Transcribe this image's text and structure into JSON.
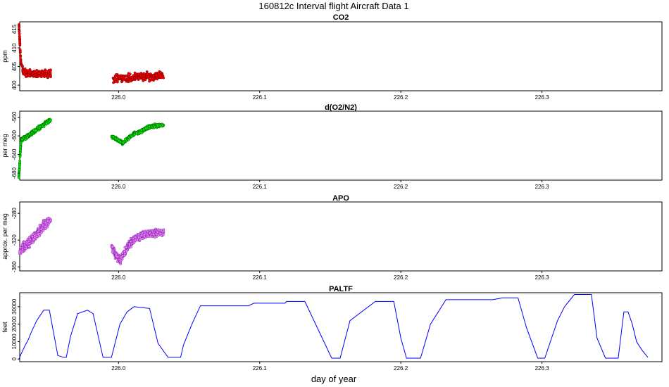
{
  "figure": {
    "title": "160812c   Interval flight Aircraft Data 1",
    "xlabel": "day of year"
  },
  "chart_data": [
    {
      "type": "scatter",
      "title": "CO2",
      "ylabel": "ppm",
      "xlim": [
        225.93,
        226.385
      ],
      "ylim": [
        398.5,
        417.0
      ],
      "xticks": [
        226.0,
        226.1,
        226.2,
        226.3
      ],
      "xtick_labels": [
        "226.0",
        "226.1",
        "226.2",
        "226.3"
      ],
      "yticks": [
        400,
        405,
        410,
        415
      ],
      "ytick_labels": [
        "400",
        "405",
        "410",
        "415"
      ],
      "fill_color": "#ff0000",
      "edge_color": "#5a0000",
      "series": [
        {
          "x": [
            225.9295,
            225.9297,
            225.93,
            225.9303,
            225.9306,
            225.931,
            225.932
          ],
          "y": [
            416.3,
            414.5,
            412.3,
            409.6,
            407.2,
            405.7,
            405.0
          ]
        },
        {
          "x": [
            225.932,
            225.936,
            225.94,
            225.944,
            225.948,
            225.952
          ],
          "y": [
            403.5,
            403.2,
            402.9,
            403.2,
            403.0,
            403.1
          ],
          "spread": 1.3
        },
        {
          "x": [
            225.996,
            226.002,
            226.008,
            226.014,
            226.02,
            226.026,
            226.032
          ],
          "y": [
            401.6,
            401.8,
            402.0,
            402.2,
            402.2,
            402.4,
            402.6
          ],
          "spread": 1.5
        }
      ]
    },
    {
      "type": "scatter",
      "title": "d(O2/N2)",
      "ylabel": "per meg",
      "xlim": [
        225.93,
        226.385
      ],
      "ylim": [
        -695,
        -547
      ],
      "xticks": [
        226.0,
        226.1,
        226.2,
        226.3
      ],
      "xtick_labels": [
        "226.0",
        "226.1",
        "226.2",
        "226.3"
      ],
      "yticks": [
        -680,
        -640,
        -600,
        -560
      ],
      "ytick_labels": [
        "-680",
        "-640",
        "-600",
        "-560"
      ],
      "fill_color": "#00ee00",
      "edge_color": "#004400",
      "series": [
        {
          "x": [
            225.9293,
            225.9297,
            225.93,
            225.9303,
            225.9306,
            225.931
          ],
          "y": [
            -690,
            -675,
            -660,
            -640,
            -625,
            -612
          ]
        },
        {
          "x": [
            225.931,
            225.934,
            225.937,
            225.94,
            225.943,
            225.946,
            225.949,
            225.952
          ],
          "y": [
            -608,
            -603,
            -598,
            -591,
            -585,
            -578,
            -571,
            -566
          ],
          "spread": 6
        },
        {
          "x": [
            225.995,
            225.999,
            226.003,
            226.007,
            226.011,
            226.015,
            226.019,
            226.023,
            226.027,
            226.032
          ],
          "y": [
            -602,
            -608,
            -615,
            -605,
            -595,
            -592,
            -585,
            -580,
            -578,
            -577
          ],
          "spread": 5
        }
      ]
    },
    {
      "type": "scatter",
      "title": "APO",
      "ylabel": "approx. per meg",
      "xlim": [
        225.93,
        226.385
      ],
      "ylim": [
        -366,
        -263
      ],
      "xticks": [
        226.0,
        226.1,
        226.2,
        226.3
      ],
      "xtick_labels": [
        "226.0",
        "226.1",
        "226.2",
        "226.3"
      ],
      "yticks": [
        -360,
        -320,
        -280
      ],
      "ytick_labels": [
        "-360",
        "-320",
        "-280"
      ],
      "fill_color": "#ee82ee",
      "edge_color": "#6a0dad",
      "series": [
        {
          "x": [
            225.93,
            225.933,
            225.936,
            225.939,
            225.942,
            225.945,
            225.948,
            225.952
          ],
          "y": [
            -335,
            -330,
            -324,
            -318,
            -310,
            -303,
            -296,
            -289
          ],
          "spread": 10
        },
        {
          "x": [
            225.995,
            225.998,
            226.001,
            226.004,
            226.007,
            226.01,
            226.014,
            226.018,
            226.022,
            226.026,
            226.032
          ],
          "y": [
            -330,
            -342,
            -350,
            -340,
            -328,
            -320,
            -315,
            -312,
            -310,
            -309,
            -308
          ],
          "spread": 8
        }
      ]
    },
    {
      "type": "line",
      "title": "PALTF",
      "ylabel": "feet",
      "xlim": [
        225.93,
        226.385
      ],
      "ylim": [
        -1500,
        38000
      ],
      "xticks": [
        226.0,
        226.1,
        226.2,
        226.3
      ],
      "xtick_labels": [
        "226.0",
        "226.1",
        "226.2",
        "226.3"
      ],
      "yticks": [
        0,
        10000,
        20000,
        30000
      ],
      "ytick_labels": [
        "0",
        "10000",
        "20000",
        "30000"
      ],
      "line_color": "#0000ff",
      "series": [
        {
          "name": "",
          "x": [
            225.9295,
            225.931,
            225.934,
            225.936,
            225.938,
            225.942,
            225.947,
            225.951,
            225.957,
            225.961,
            225.963,
            225.966,
            225.971,
            225.978,
            225.982,
            225.989,
            225.995,
            226.001,
            226.006,
            226.011,
            226.016,
            226.022,
            226.028,
            226.035,
            226.044,
            226.046,
            226.052,
            226.058,
            226.066,
            226.092,
            226.096,
            226.118,
            226.119,
            226.132,
            226.142,
            226.151,
            226.157,
            226.164,
            226.182,
            226.195,
            226.2,
            226.204,
            226.214,
            226.221,
            226.232,
            226.265,
            226.272,
            226.283,
            226.289,
            226.297,
            226.302,
            226.311,
            226.316,
            226.323,
            226.335,
            226.339,
            226.345,
            226.354,
            226.358,
            226.361,
            226.364,
            226.367,
            226.371,
            226.375
          ],
          "y": [
            0,
            3000,
            8000,
            11000,
            15000,
            22000,
            28000,
            28000,
            2000,
            1000,
            1000,
            13000,
            26000,
            28000,
            26000,
            1000,
            1000,
            20000,
            27000,
            30000,
            29500,
            29000,
            9000,
            1000,
            1000,
            8000,
            20000,
            30500,
            30500,
            30500,
            32000,
            32000,
            33000,
            33000,
            16000,
            500,
            500,
            22000,
            33000,
            33000,
            12000,
            500,
            500,
            20000,
            34000,
            34000,
            35000,
            35000,
            18000,
            500,
            500,
            22000,
            30000,
            37000,
            37000,
            12000,
            500,
            500,
            27000,
            27000,
            20000,
            10000,
            5000,
            1000
          ]
        }
      ]
    }
  ]
}
